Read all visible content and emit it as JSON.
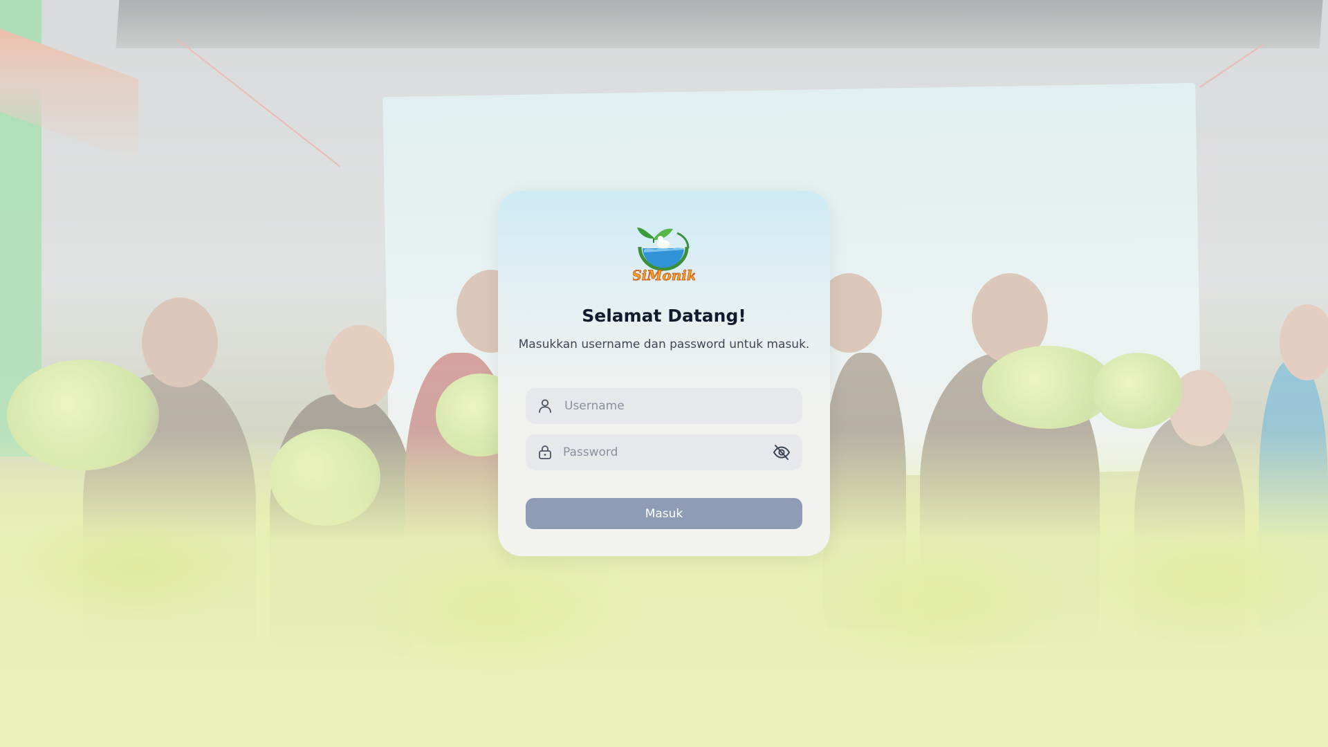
{
  "login": {
    "logo_icon": "simonik-logo-icon",
    "logo_text": "SiMonik",
    "title": "Selamat Datang!",
    "subtitle": "Masukkan username dan password untuk masuk.",
    "username": {
      "placeholder": "Username",
      "value": "",
      "icon": "user-icon"
    },
    "password": {
      "placeholder": "Password",
      "value": "",
      "icon": "lock-icon",
      "toggle_icon": "eye-off-icon"
    },
    "submit_label": "Masuk"
  },
  "colors": {
    "button": "#8f9cb5",
    "field_bg": "#e6e8ec",
    "title": "#131a2b",
    "subtitle": "#3f4757"
  }
}
